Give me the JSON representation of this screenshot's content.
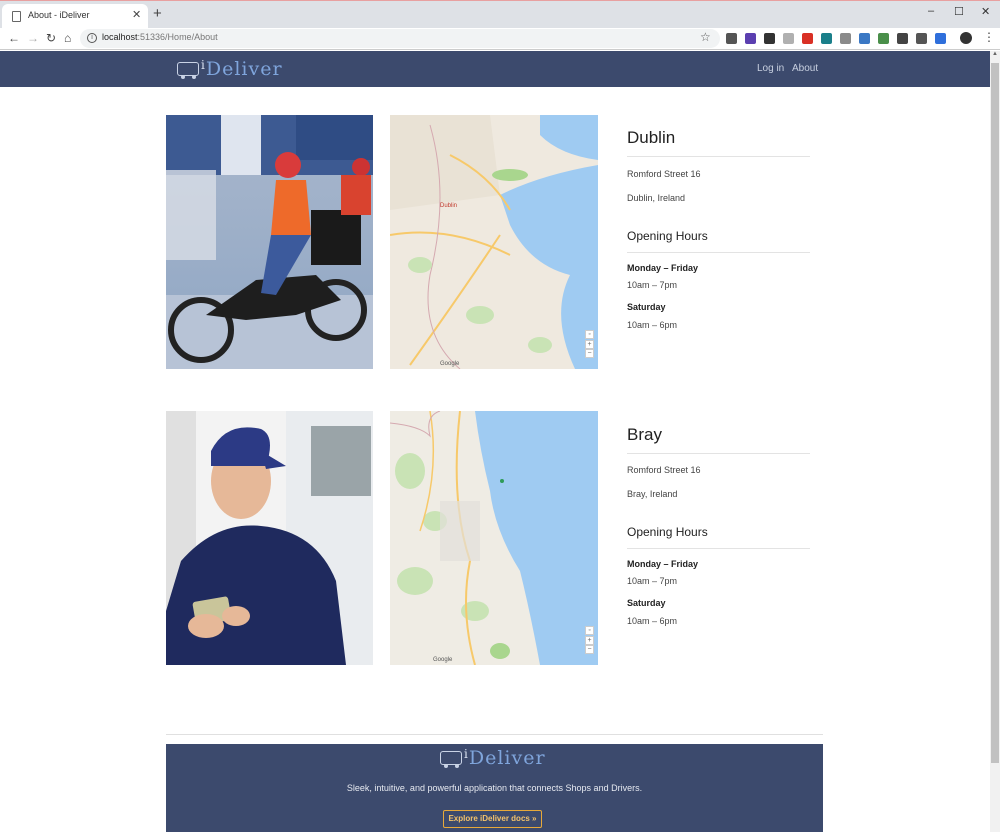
{
  "browser": {
    "tab_title": "About - iDeliver",
    "url_host": "localhost",
    "url_rest": ":51336/Home/About",
    "newtab": "+",
    "close": "✕",
    "minimize": "–",
    "maximize": "☐",
    "window_close": "✕",
    "extensions": [
      {
        "name": "dropper-icon",
        "color": "#555555"
      },
      {
        "name": "purple-hex-icon",
        "color": "#5b3fb0"
      },
      {
        "name": "dark-square-icon",
        "color": "#333333"
      },
      {
        "name": "grey-circle-icon",
        "color": "#b0b0b0"
      },
      {
        "name": "stop-icon",
        "color": "#d93025"
      },
      {
        "name": "teal-c-icon",
        "color": "#1a7f8a"
      },
      {
        "name": "page-icon",
        "color": "#8a8a8a"
      },
      {
        "name": "blue-card-icon",
        "color": "#3b78c4"
      },
      {
        "name": "green-grid-icon",
        "color": "#4a8f4a"
      },
      {
        "name": "block-icon",
        "color": "#444444"
      },
      {
        "name": "frame-icon",
        "color": "#555555"
      },
      {
        "name": "dropbox-icon",
        "color": "#2f6fdb"
      },
      {
        "name": "shield-icon",
        "color": "#4b68d8"
      }
    ]
  },
  "header": {
    "logo_i": "i",
    "logo_text": "Deliver",
    "nav": [
      "Log in",
      "About"
    ]
  },
  "locations": [
    {
      "city": "Dublin",
      "street": "Romford Street 16",
      "region": "Dublin, Ireland",
      "hours_title": "Opening Hours",
      "weekday_label": "Monday – Friday",
      "weekday_hours": "10am – 7pm",
      "saturday_label": "Saturday",
      "saturday_hours": "10am – 6pm",
      "map_google": "Google"
    },
    {
      "city": "Bray",
      "street": "Romford Street 16",
      "region": "Bray, Ireland",
      "hours_title": "Opening Hours",
      "weekday_label": "Monday – Friday",
      "weekday_hours": "10am – 7pm",
      "saturday_label": "Saturday",
      "saturday_hours": "10am – 6pm",
      "map_google": "Google"
    }
  ],
  "footer": {
    "logo_i": "i",
    "logo_text": "Deliver",
    "tagline": "Sleek, intuitive, and powerful application that connects Shops and Drivers.",
    "docs_button": "Explore iDeliver docs »"
  },
  "colors": {
    "header_bg": "#3c4a6d",
    "logo": "#7fa5dc",
    "button_accent": "#e7a93a"
  }
}
